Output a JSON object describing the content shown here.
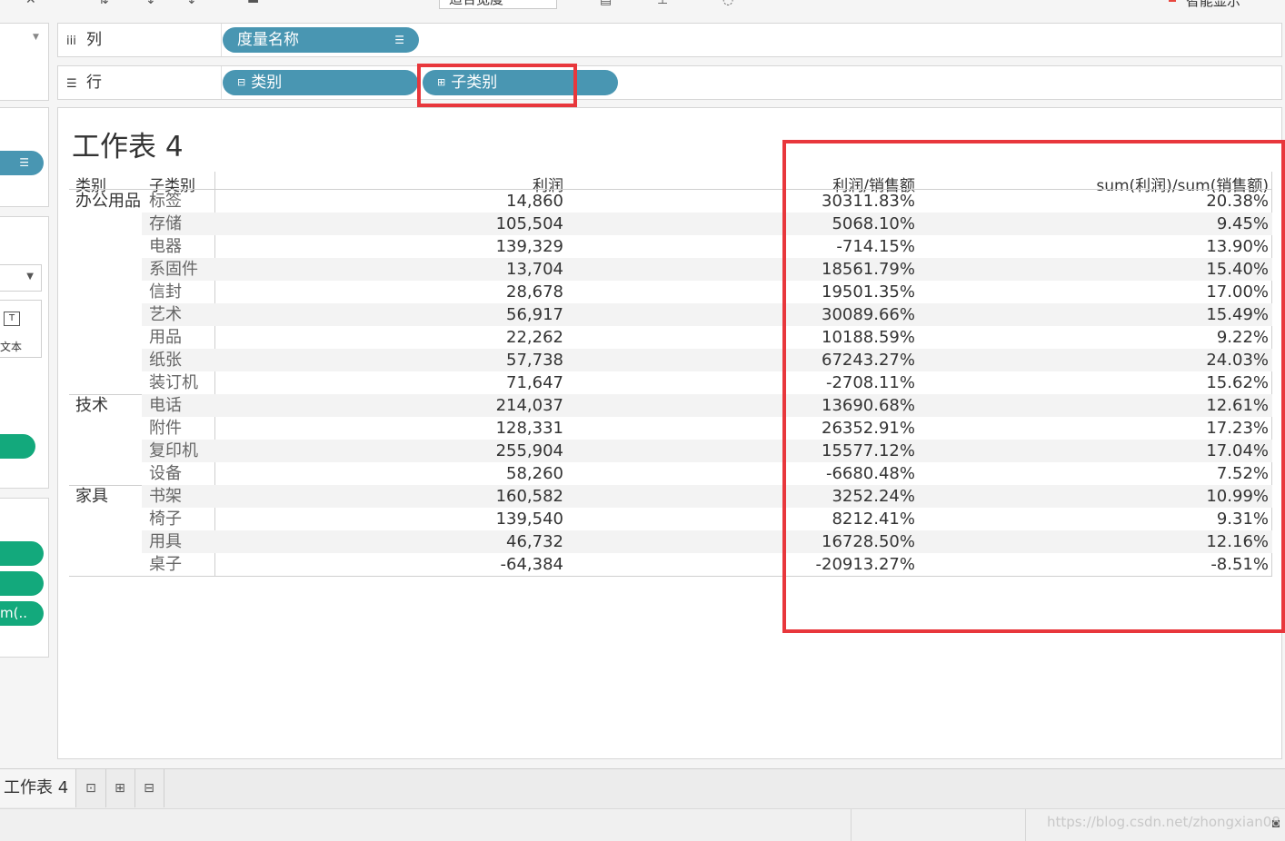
{
  "toolbar": {
    "fit_label": "适合宽度",
    "smart_show_label": "智能显示"
  },
  "shelves": {
    "columns": {
      "label": "列",
      "icon": "columns-icon",
      "pills": [
        "度量名称"
      ]
    },
    "rows": {
      "label": "行",
      "icon": "rows-icon",
      "pills": [
        "类别",
        "子类别"
      ]
    }
  },
  "left_panel": {
    "marks_text_label": "文本",
    "truncated_pill": "m(.."
  },
  "worksheet": {
    "title": "工作表 4",
    "headers": {
      "category": "类别",
      "subcategory": "子类别",
      "profit": "利润",
      "profit_ratio": "利润/销售额",
      "sum_ratio": "sum(利润)/sum(销售额)"
    },
    "groups": [
      {
        "category": "办公用品",
        "rows": [
          {
            "sub": "标签",
            "profit": "14,860",
            "ratio": "30311.83%",
            "sum_ratio": "20.38%"
          },
          {
            "sub": "存储",
            "profit": "105,504",
            "ratio": "5068.10%",
            "sum_ratio": "9.45%"
          },
          {
            "sub": "电器",
            "profit": "139,329",
            "ratio": "-714.15%",
            "sum_ratio": "13.90%"
          },
          {
            "sub": "系固件",
            "profit": "13,704",
            "ratio": "18561.79%",
            "sum_ratio": "15.40%"
          },
          {
            "sub": "信封",
            "profit": "28,678",
            "ratio": "19501.35%",
            "sum_ratio": "17.00%"
          },
          {
            "sub": "艺术",
            "profit": "56,917",
            "ratio": "30089.66%",
            "sum_ratio": "15.49%"
          },
          {
            "sub": "用品",
            "profit": "22,262",
            "ratio": "10188.59%",
            "sum_ratio": "9.22%"
          },
          {
            "sub": "纸张",
            "profit": "57,738",
            "ratio": "67243.27%",
            "sum_ratio": "24.03%"
          },
          {
            "sub": "装订机",
            "profit": "71,647",
            "ratio": "-2708.11%",
            "sum_ratio": "15.62%"
          }
        ]
      },
      {
        "category": "技术",
        "rows": [
          {
            "sub": "电话",
            "profit": "214,037",
            "ratio": "13690.68%",
            "sum_ratio": "12.61%"
          },
          {
            "sub": "附件",
            "profit": "128,331",
            "ratio": "26352.91%",
            "sum_ratio": "17.23%"
          },
          {
            "sub": "复印机",
            "profit": "255,904",
            "ratio": "15577.12%",
            "sum_ratio": "17.04%"
          },
          {
            "sub": "设备",
            "profit": "58,260",
            "ratio": "-6680.48%",
            "sum_ratio": "7.52%"
          }
        ]
      },
      {
        "category": "家具",
        "rows": [
          {
            "sub": "书架",
            "profit": "160,582",
            "ratio": "3252.24%",
            "sum_ratio": "10.99%"
          },
          {
            "sub": "椅子",
            "profit": "139,540",
            "ratio": "8212.41%",
            "sum_ratio": "9.31%"
          },
          {
            "sub": "用具",
            "profit": "46,732",
            "ratio": "16728.50%",
            "sum_ratio": "12.16%"
          },
          {
            "sub": "桌子",
            "profit": "-64,384",
            "ratio": "-20913.27%",
            "sum_ratio": "-8.51%"
          }
        ]
      }
    ]
  },
  "tabs": {
    "active": "工作表 4"
  },
  "status": {
    "watermark": "https://blog.csdn.net/zhongxian08"
  },
  "colors": {
    "pill_blue": "#4996b2",
    "pill_green": "#13a97c",
    "annotation_red": "#e8373c"
  }
}
